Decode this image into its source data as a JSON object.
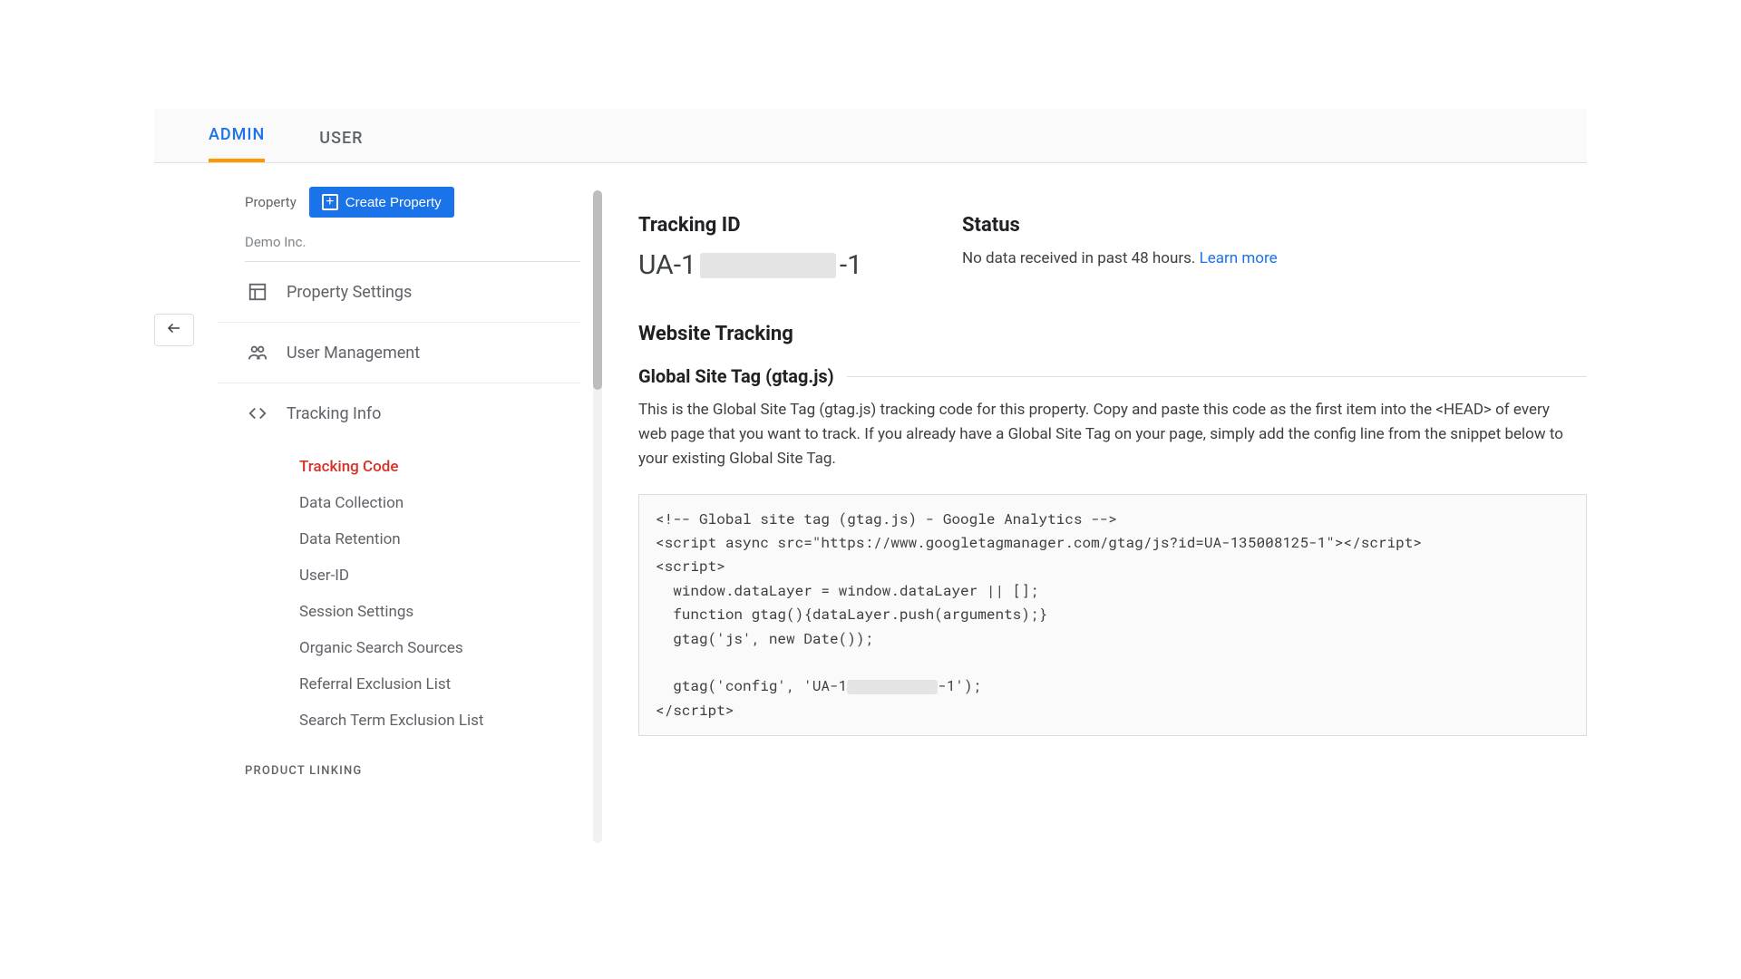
{
  "tabs": {
    "admin": "ADMIN",
    "user": "USER"
  },
  "sidebar": {
    "property_label": "Property",
    "create_button": "Create Property",
    "property_name": "Demo Inc.",
    "items": {
      "property_settings": "Property Settings",
      "user_management": "User Management",
      "tracking_info": "Tracking Info"
    },
    "tracking_sub": {
      "tracking_code": "Tracking Code",
      "data_collection": "Data Collection",
      "data_retention": "Data Retention",
      "user_id": "User-ID",
      "session_settings": "Session Settings",
      "organic_search": "Organic Search Sources",
      "referral_exclusion": "Referral Exclusion List",
      "search_term_exclusion": "Search Term Exclusion List"
    },
    "product_linking": "PRODUCT LINKING"
  },
  "main": {
    "tracking_id_label": "Tracking ID",
    "tracking_id_prefix": "UA-1",
    "tracking_id_suffix": "-1",
    "status_label": "Status",
    "status_text": "No data received in past 48 hours. ",
    "learn_more": "Learn more",
    "website_tracking": "Website Tracking",
    "gtag_heading": "Global Site Tag (gtag.js)",
    "gtag_desc": "This is the Global Site Tag (gtag.js) tracking code for this property. Copy and paste this code as the first item into the <HEAD> of every web page that you want to track. If you already have a Global Site Tag on your page, simply add the config line from the snippet below to your existing Global Site Tag.",
    "code": {
      "l1": "<!-- Global site tag (gtag.js) - Google Analytics -->",
      "l2": "<script async src=\"https://www.googletagmanager.com/gtag/js?id=UA-135008125-1\"></script>",
      "l3": "<script>",
      "l4": "  window.dataLayer = window.dataLayer || [];",
      "l5": "  function gtag(){dataLayer.push(arguments);}",
      "l6": "  gtag('js', new Date());",
      "l7": "",
      "l8a": "  gtag('config', 'UA-1",
      "l8b": "-1');",
      "l9": "</script>"
    }
  }
}
